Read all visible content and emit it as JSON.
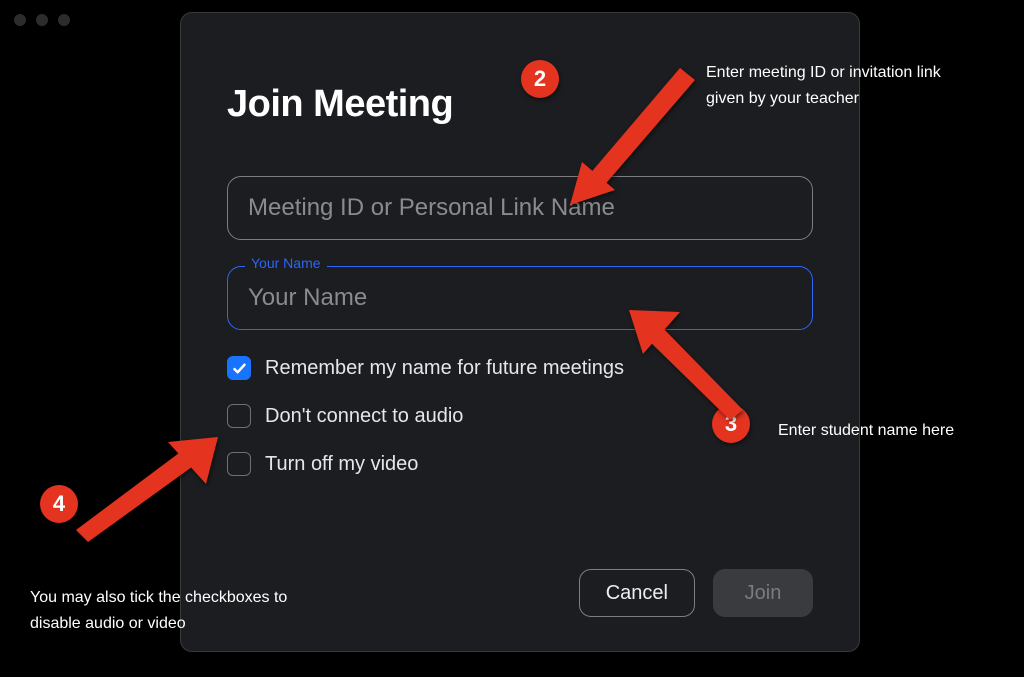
{
  "dialog": {
    "title": "Join Meeting",
    "meeting_id_placeholder": "Meeting ID or Personal Link Name",
    "name_label": "Your Name",
    "name_placeholder": "Your Name",
    "options": {
      "remember": "Remember my name for future meetings",
      "no_audio": "Don't connect to audio",
      "no_video": "Turn off my video"
    },
    "buttons": {
      "cancel": "Cancel",
      "join": "Join"
    }
  },
  "annotations": {
    "badge2": "2",
    "caption2": "Enter meeting ID  or invitation link given by your teacher",
    "badge3": "3",
    "caption3": "Enter student name here",
    "badge4": "4",
    "caption4": "You may also tick the checkboxes to disable audio or video"
  }
}
